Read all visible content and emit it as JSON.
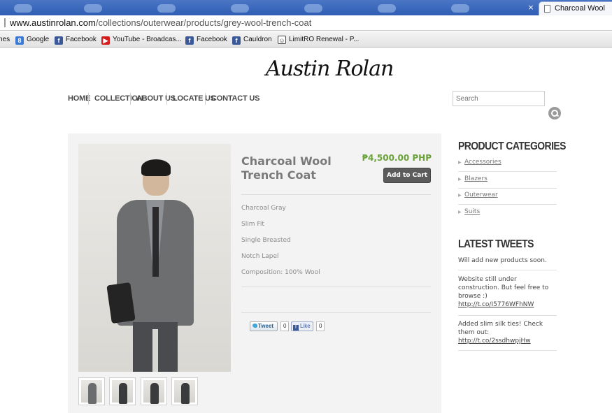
{
  "browser": {
    "tab_title": "Charcoal Wool",
    "tab_close": "×",
    "url_domain": "www.austinrolan.com",
    "url_path": "/collections/outerwear/products/grey-wool-trench-coat",
    "bookmarks": [
      {
        "label": "nes",
        "icon": "none"
      },
      {
        "label": "Google",
        "icon": "google-icon"
      },
      {
        "label": "Facebook",
        "icon": "facebook-icon"
      },
      {
        "label": "YouTube - Broadcas...",
        "icon": "youtube-icon"
      },
      {
        "label": "Facebook",
        "icon": "facebook-icon"
      },
      {
        "label": "Cauldron",
        "icon": "facebook-icon"
      },
      {
        "label": "LimitRO Renewal - P...",
        "icon": "limitro-icon"
      }
    ]
  },
  "site": {
    "logo": "Austin Rolan",
    "nav": [
      "Home",
      "Collection",
      "About Us",
      "Locate Us",
      "Contact Us"
    ],
    "search_placeholder": "Search"
  },
  "product": {
    "title": "Charcoal Wool Trench Coat",
    "price": "₱4,500.00 PHP",
    "add_to_cart": "Add to Cart",
    "features": [
      "Charcoal Gray",
      "Slim Fit",
      "Single Breasted",
      "Notch Lapel",
      "Composition: 100% Wool"
    ],
    "share": {
      "tweet_label": "Tweet",
      "tweet_count": "0",
      "like_label": "Like",
      "like_count": "0"
    }
  },
  "sidebar": {
    "categories_heading": "Product Categories",
    "categories": [
      "Accessories",
      "Blazers",
      "Outerwear",
      "Suits"
    ],
    "tweets_heading": "Latest Tweets",
    "tweets": [
      {
        "text": "Will add new products soon.",
        "link": ""
      },
      {
        "text": "Website still under construction. But feel free to browse :)",
        "link": "http://t.co/I5776WFhNW"
      },
      {
        "text": "Added slim silk ties! Check them out:",
        "link": "http://t.co/2ssdhwpjHw"
      }
    ]
  },
  "colors": {
    "price_green": "#6aa23a",
    "button_dark": "#5c5c5c",
    "tab_strip_blue": "#3a66bb"
  }
}
